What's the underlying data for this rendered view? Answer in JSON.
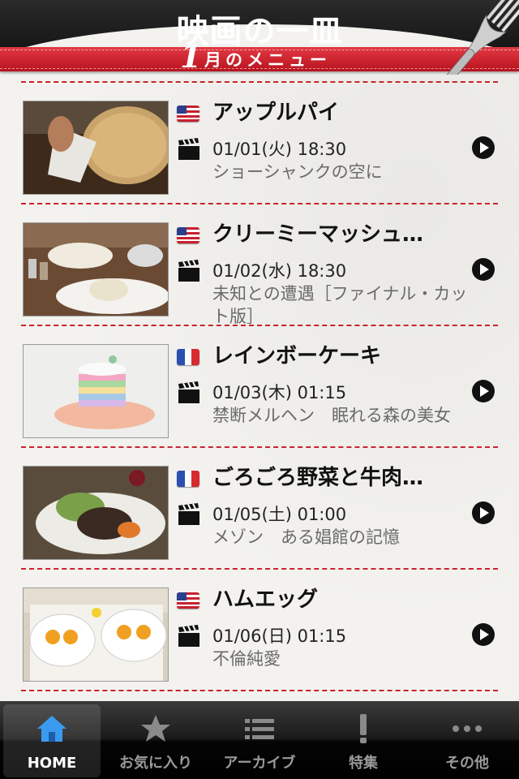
{
  "header": {
    "title": "映画の一皿",
    "month": "1",
    "menu_label": "月のメニュー"
  },
  "items": [
    {
      "flag": "us",
      "title": "アップルパイ",
      "datetime": "01/01(火) 18:30",
      "movie": "ショーシャンクの空に"
    },
    {
      "flag": "us",
      "title": "クリーミーマッシュ…",
      "datetime": "01/02(水) 18:30",
      "movie": "未知との遭遇［ファイナル・カット版］"
    },
    {
      "flag": "fr",
      "title": "レインボーケーキ",
      "datetime": "01/03(木) 01:15",
      "movie": "禁断メルヘン　眠れる森の美女"
    },
    {
      "flag": "fr",
      "title": "ごろごろ野菜と牛肉…",
      "datetime": "01/05(土) 01:00",
      "movie": "メゾン　ある娼館の記憶"
    },
    {
      "flag": "us",
      "title": "ハムエッグ",
      "datetime": "01/06(日) 01:15",
      "movie": "不倫純愛"
    }
  ],
  "tabs": [
    {
      "label": "HOME",
      "icon": "home-icon",
      "active": true
    },
    {
      "label": "お気に入り",
      "icon": "star-icon"
    },
    {
      "label": "アーカイブ",
      "icon": "list-icon"
    },
    {
      "label": "特集",
      "icon": "exclamation-icon"
    },
    {
      "label": "その他",
      "icon": "more-icon"
    }
  ],
  "colors": {
    "accent": "#c9242c",
    "tab_active": "#2f8ee6"
  }
}
